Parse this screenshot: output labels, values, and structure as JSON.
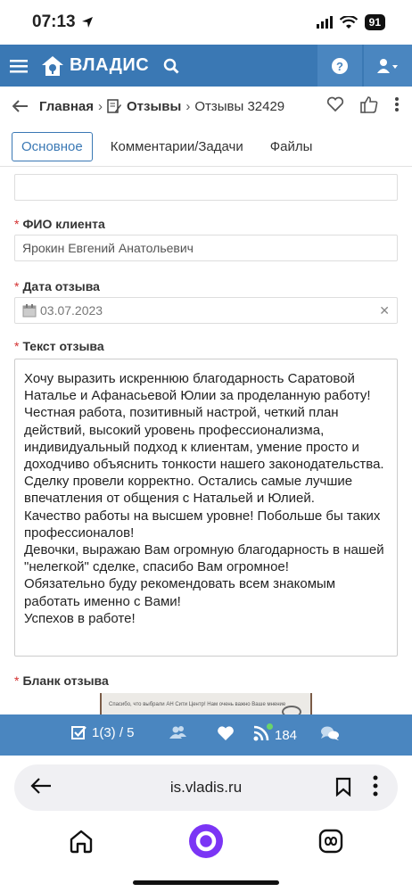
{
  "status": {
    "time": "07:13",
    "battery": "91"
  },
  "app": {
    "brand": "ВЛАДИС",
    "accent": "#3a78b4"
  },
  "breadcrumb": {
    "home": "Главная",
    "section": "Отзывы",
    "current": "Отзывы 32429"
  },
  "tabs": [
    {
      "label": "Основное",
      "active": true
    },
    {
      "label": "Комментарии/Задачи"
    },
    {
      "label": "Файлы"
    }
  ],
  "form": {
    "client_label": "ФИО клиента",
    "client_value": "Ярокин Евгений Анатольевич",
    "date_label": "Дата отзыва",
    "date_value": "03.07.2023",
    "text_label": "Текст отзыва",
    "text_value": "Хочу выразить искреннюю благодарность Саратовой Наталье и Афанасьевой Юлии за проделанную работу! Честная работа, позитивный настрой, четкий план действий, высокий уровень профессионализма, индивидуальный подход к клиентам, умение просто и доходчиво объяснить тонкости нашего законодательства.\nСделку провели корректно. Остались самые лучшие впечатления от общения с Натальей и Юлией.\nКачество работы на высшем уровне! Побольше бы таких профессионалов!\nДевочки, выражаю Вам огромную благодарность в нашей \"нелегкой\" сделке, спасибо Вам огромное!\nОбязательно буду рекомендовать всем знакомым работать именно с Вами!\nУспехов в работе!",
    "blank_label": "Бланк отзыва",
    "blank_img_text": "Спасибо, что выбрали АН Сити Центр!\nНам очень важно Ваше мнение"
  },
  "toolbar": {
    "tasks": "1(3) / 5",
    "rss_count": "184"
  },
  "browser": {
    "url": "is.vladis.ru"
  }
}
